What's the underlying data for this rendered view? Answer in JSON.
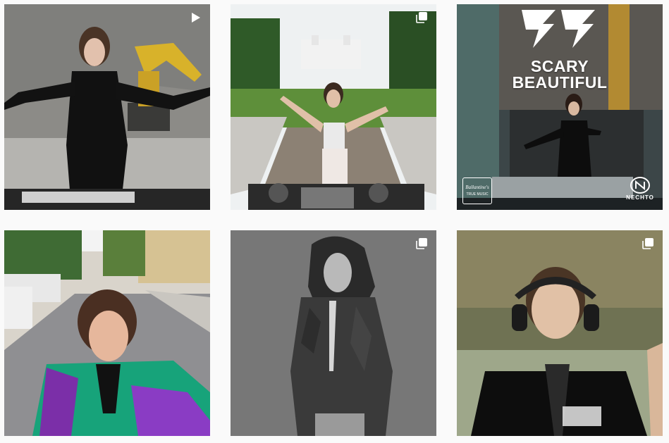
{
  "grid": {
    "posts": [
      {
        "alt": "DJ in black bodysuit at quarry with excavator",
        "badge": "video-icon"
      },
      {
        "alt": "DJ in white top at estate terrace with palace",
        "badge": "carousel-icon"
      },
      {
        "alt": "Scary Beautiful poster with DJ in industrial space",
        "badge": "none",
        "headline_line1": "SCARY",
        "headline_line2": "BEAUTIFUL",
        "left_logo_line1": "Ballantine's",
        "left_logo_line2": "TRUE MUSIC",
        "right_logo": "NECHTO"
      },
      {
        "alt": "Selfie on city street in purple and green jacket",
        "badge": "none"
      },
      {
        "alt": "Black and white portrait in hooded rain jacket",
        "badge": "carousel-icon"
      },
      {
        "alt": "DJ with headphones in black jacket looking up",
        "badge": "carousel-icon"
      }
    ]
  }
}
